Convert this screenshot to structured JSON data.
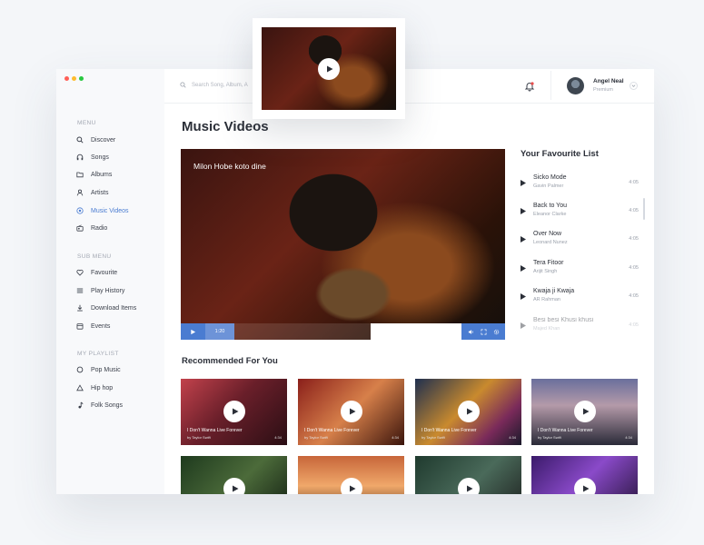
{
  "window": {
    "dot_colors": [
      "#ff5f57",
      "#febc2e",
      "#28c840"
    ]
  },
  "sidebar": {
    "menu_title": "MENU",
    "menu": [
      {
        "icon": "search-icon",
        "label": "Discover",
        "active": false
      },
      {
        "icon": "headphones-icon",
        "label": "Songs",
        "active": false
      },
      {
        "icon": "folder-icon",
        "label": "Albums",
        "active": false
      },
      {
        "icon": "user-icon",
        "label": "Artists",
        "active": false
      },
      {
        "icon": "video-icon",
        "label": "Music Videos",
        "active": true
      },
      {
        "icon": "radio-icon",
        "label": "Radio",
        "active": false
      }
    ],
    "submenu_title": "SUB MENU",
    "submenu": [
      {
        "icon": "heart-icon",
        "label": "Favourite"
      },
      {
        "icon": "list-icon",
        "label": "Play History"
      },
      {
        "icon": "download-icon",
        "label": "Download Items"
      },
      {
        "icon": "calendar-icon",
        "label": "Events"
      }
    ],
    "playlist_title": "MY PLAYLIST",
    "playlists": [
      {
        "icon": "circle-icon",
        "label": "Pop Music"
      },
      {
        "icon": "triangle-icon",
        "label": "Hip hop"
      },
      {
        "icon": "music-note-icon",
        "label": "Folk Songs"
      }
    ]
  },
  "header": {
    "search_placeholder": "Search Song, Album, A",
    "user_name": "Angel Neal",
    "user_plan": "Premium"
  },
  "page_title": "Music Videos",
  "player": {
    "caption": "Milon Hobe koto dine",
    "current_time": "1:20"
  },
  "favourites": {
    "title": "Your Favourite List",
    "items": [
      {
        "song": "Sicko Mode",
        "artist": "Gavin Palmer",
        "time": "4:05"
      },
      {
        "song": "Back to You",
        "artist": "Eleanor Clarke",
        "time": "4:05"
      },
      {
        "song": "Over Now",
        "artist": "Leonard Nunez",
        "time": "4:05"
      },
      {
        "song": "Tera Fitoor",
        "artist": "Arijit Singh",
        "time": "4:05"
      },
      {
        "song": "Kwaja ji Kwaja",
        "artist": "AR Rahman",
        "time": "4:05"
      },
      {
        "song": "Besi besi Khusi khusi",
        "artist": "Majed Khan",
        "time": "4:05"
      }
    ]
  },
  "recommended": {
    "title": "Recommended For You",
    "cards": [
      {
        "title": "I Don't Wanna Live Forever",
        "artist": "by Taylor Swift",
        "time": "4:34",
        "bg": "linear-gradient(135deg,#c2424c 0%,#6a1f2a 45%,#2a0e14 100%)"
      },
      {
        "title": "I Don't Wanna Live Forever",
        "artist": "by Taylor Swift",
        "time": "4:34",
        "bg": "linear-gradient(135deg,#8a1f1a 0%,#d7804a 50%,#3a140c 100%)"
      },
      {
        "title": "I Don't Wanna Live Forever",
        "artist": "by Taylor Swift",
        "time": "4:34",
        "bg": "linear-gradient(135deg,#1f2f4f 0%,#c98a2e 45%,#7a2a5a 75%,#1a1a2a 100%)"
      },
      {
        "title": "I Don't Wanna Live Forever",
        "artist": "by Taylor Swift",
        "time": "4:34",
        "bg": "linear-gradient(180deg,#6a6f9c 0%,#b49aa9 40%,#2a2a38 100%)"
      },
      {
        "title": "",
        "artist": "",
        "time": "",
        "bg": "linear-gradient(135deg,#1e3a1e 0%,#4c6b3a 50%,#0f1a10 100%)"
      },
      {
        "title": "",
        "artist": "",
        "time": "",
        "bg": "linear-gradient(180deg,#c7663a 0%,#f0a86a 45%,#3a1a0c 100%)"
      },
      {
        "title": "",
        "artist": "",
        "time": "",
        "bg": "linear-gradient(135deg,#1f3a2e 0%,#4a6a5a 50%,#1a1a1a 100%)"
      },
      {
        "title": "",
        "artist": "",
        "time": "",
        "bg": "linear-gradient(135deg,#3a1a6a 0%,#8a4ac9 45%,#1a0e2a 100%)"
      }
    ]
  },
  "colors": {
    "accent": "#4a7cd1",
    "accent_light": "#6d93d8",
    "bell_badge": "#e84b4b"
  }
}
